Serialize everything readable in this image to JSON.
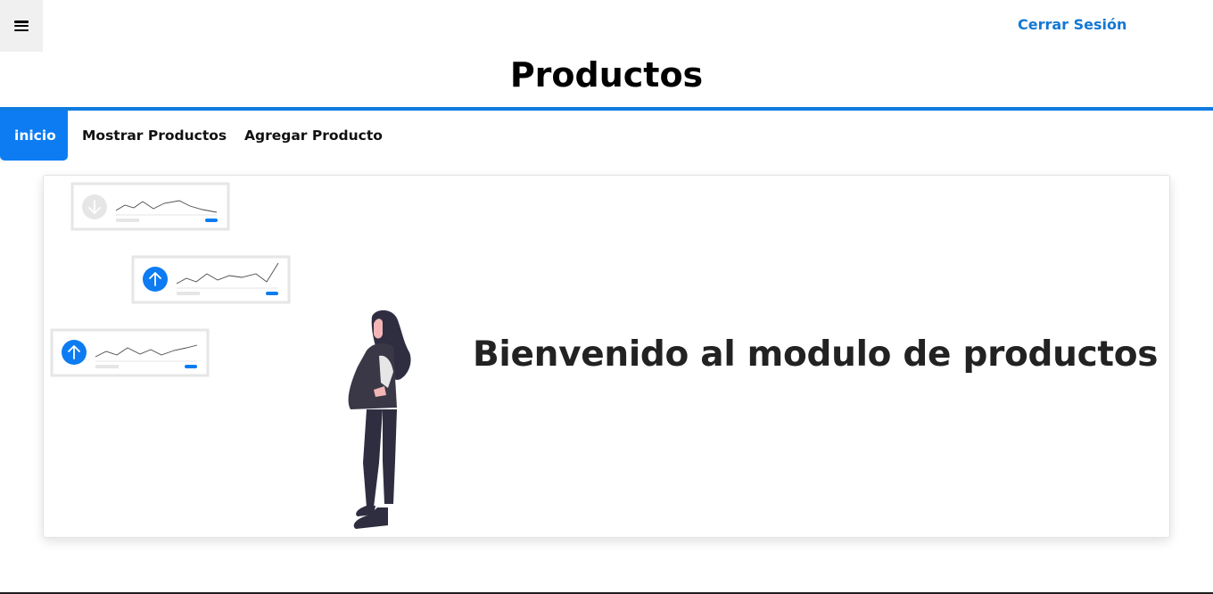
{
  "header": {
    "menu_icon": "hamburger-icon",
    "logout_label": "Cerrar Sesión",
    "title": "Productos"
  },
  "nav": {
    "tabs": [
      {
        "label": "inicio",
        "active": true
      },
      {
        "label": "Mostrar Productos",
        "active": false
      },
      {
        "label": "Agregar Producto",
        "active": false
      }
    ]
  },
  "main": {
    "welcome_text": "Bienvenido al modulo de productos",
    "illustration_icons": [
      "arrow-down-icon",
      "arrow-up-icon",
      "arrow-up-icon"
    ]
  },
  "colors": {
    "accent": "#0d7cf2",
    "link": "#1478d4",
    "text_dark": "#222222"
  }
}
